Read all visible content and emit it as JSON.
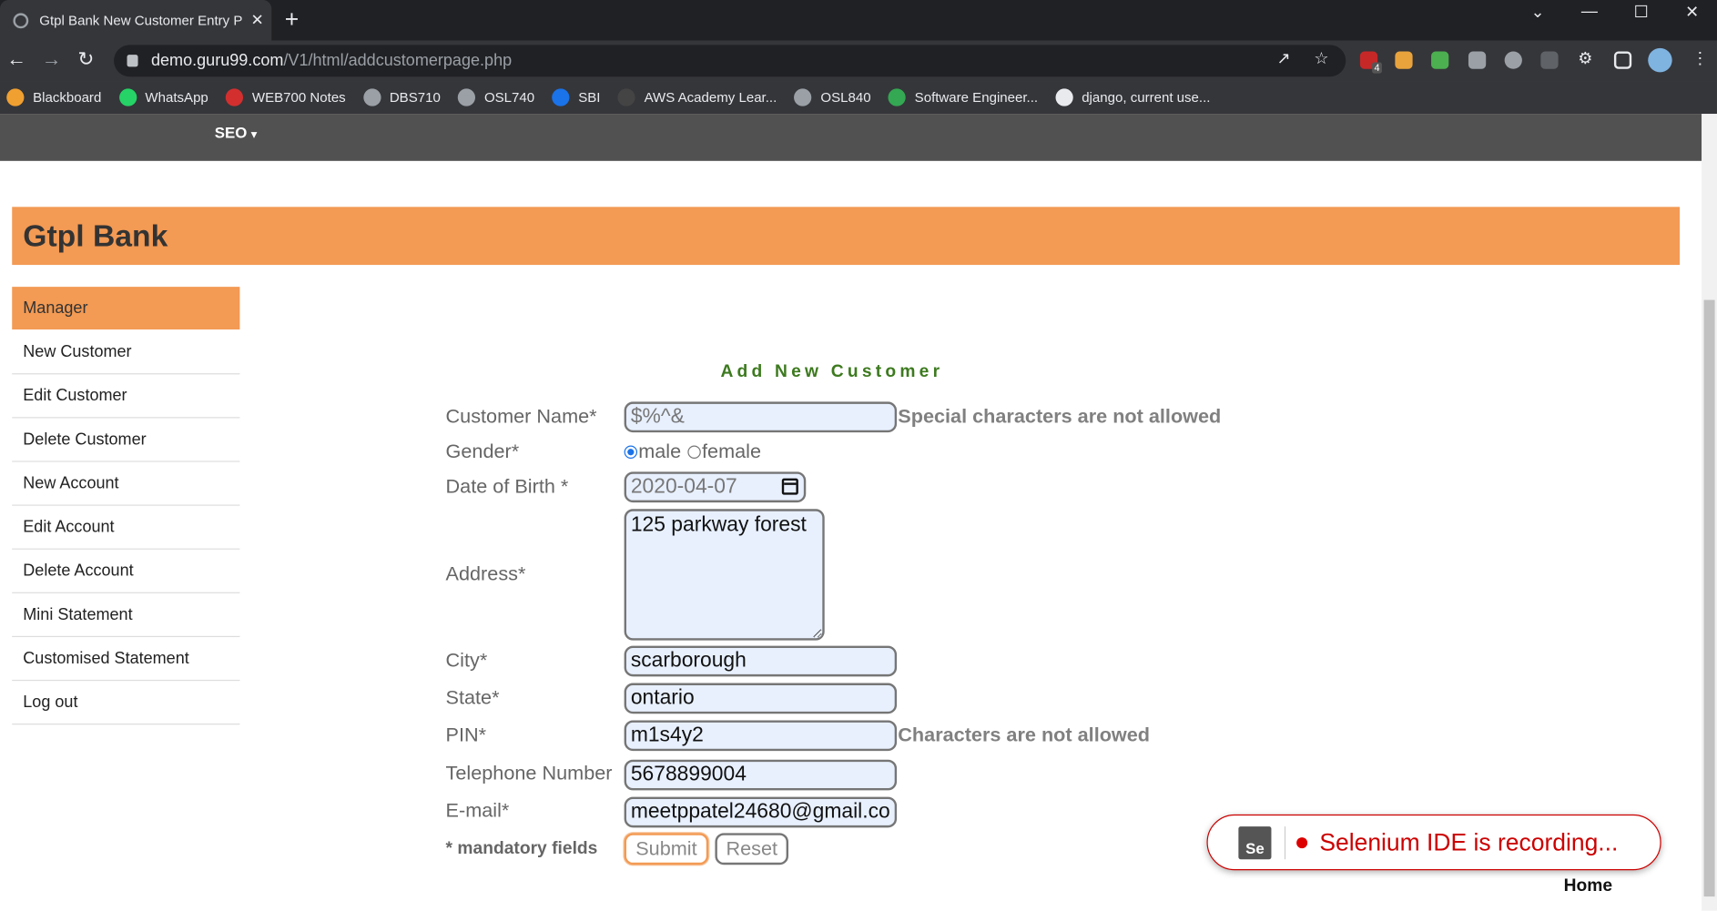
{
  "browser": {
    "tab_title": "Gtpl Bank New Customer Entry P",
    "tab_close": "✕",
    "new_tab": "+",
    "url_host": "demo.guru99.com",
    "url_path": "/V1/html/addcustomerpage.php",
    "window_controls": [
      "⌄",
      "—",
      "☐",
      "✕"
    ],
    "extension_badge": "4",
    "bookmarks": [
      {
        "label": "Blackboard",
        "icon": "blackboard-icon",
        "color": "#f0a030"
      },
      {
        "label": "WhatsApp",
        "icon": "whatsapp-icon",
        "color": "#25d366"
      },
      {
        "label": "WEB700 Notes",
        "icon": "ict-icon",
        "color": "#d32f2f"
      },
      {
        "label": "DBS710",
        "icon": "globe-icon",
        "color": "#9aa0a6"
      },
      {
        "label": "OSL740",
        "icon": "globe-icon",
        "color": "#9aa0a6"
      },
      {
        "label": "SBI",
        "icon": "sbi-icon",
        "color": "#1a73e8"
      },
      {
        "label": "AWS Academy Lear...",
        "icon": "aws-icon",
        "color": "#444"
      },
      {
        "label": "OSL840",
        "icon": "globe-icon",
        "color": "#9aa0a6"
      },
      {
        "label": "Software Engineer...",
        "icon": "leaf-icon",
        "color": "#34a853"
      },
      {
        "label": "django, current use...",
        "icon": "github-icon",
        "color": "#e8eaed"
      }
    ]
  },
  "site": {
    "nav_item": "SEO",
    "nav_caret": "▾",
    "brand": "Gtpl Bank",
    "home_link": "Home"
  },
  "sidebar": {
    "items": [
      {
        "label": "Manager",
        "active": true
      },
      {
        "label": "New Customer"
      },
      {
        "label": "Edit Customer"
      },
      {
        "label": "Delete Customer"
      },
      {
        "label": "New Account"
      },
      {
        "label": "Edit Account"
      },
      {
        "label": "Delete Account"
      },
      {
        "label": "Mini Statement"
      },
      {
        "label": "Customised Statement"
      },
      {
        "label": "Log out"
      }
    ]
  },
  "form": {
    "title": "Add New Customer",
    "customer_name": {
      "label": "Customer Name*",
      "value": "$%^&",
      "error": "Special characters are not allowed"
    },
    "gender": {
      "label": "Gender*",
      "options": [
        "male",
        "female"
      ],
      "selected": "male"
    },
    "dob": {
      "label": "Date of Birth *",
      "value": "2020-04-07"
    },
    "address": {
      "label": "Address*",
      "value": "125 parkway forest"
    },
    "city": {
      "label": "City*",
      "value": "scarborough"
    },
    "state": {
      "label": "State*",
      "value": "ontario"
    },
    "pin": {
      "label": "PIN*",
      "value": "m1s4y2",
      "error": "Characters are not allowed"
    },
    "telephone": {
      "label": "Telephone Number",
      "value": "5678899004"
    },
    "email": {
      "label": "E-mail*",
      "value": "meetppatel24680@gmail.co"
    },
    "mandatory_note": "* mandatory fields",
    "submit_label": "Submit",
    "reset_label": "Reset"
  },
  "selenium": {
    "logo_text": "Se",
    "status": "Selenium IDE is recording..."
  }
}
